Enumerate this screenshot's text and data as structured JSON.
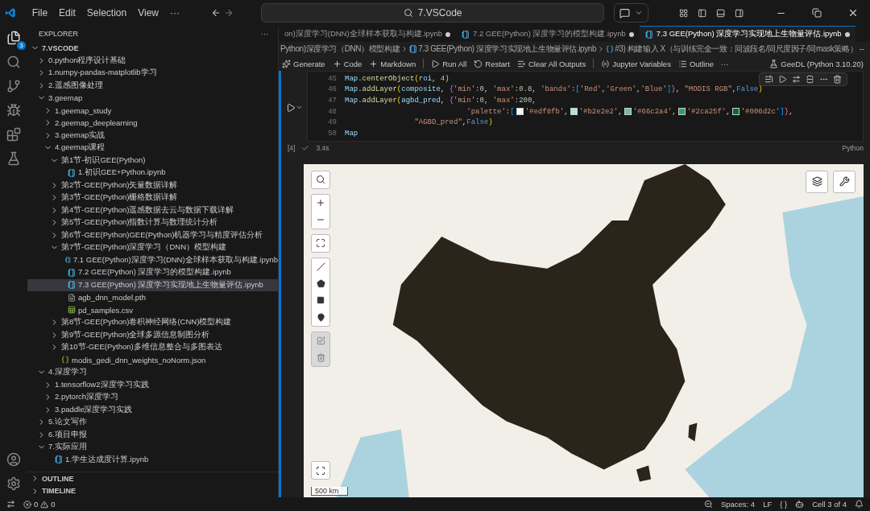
{
  "title_bar": {
    "menus": [
      "File",
      "Edit",
      "Selection",
      "View"
    ],
    "more": "···",
    "search": "7.VSCode"
  },
  "activity_bar": {
    "explorer_badge": "3"
  },
  "sidebar": {
    "title": "EXPLORER",
    "more": "···",
    "root": "7.VSCODE",
    "root_expanded": true,
    "items": [
      {
        "label": "0.python程序设计基础",
        "kind": "folder",
        "expanded": false,
        "selected": false
      },
      {
        "label": "1.numpy-pandas-matplotlib学习",
        "kind": "folder",
        "expanded": false,
        "selected": false
      },
      {
        "label": "2.遥感图像处理",
        "kind": "folder",
        "expanded": false,
        "selected": false
      },
      {
        "label": "3.geemap",
        "kind": "folder",
        "expanded": true,
        "selected": false,
        "children": [
          {
            "label": "1.geemap_study",
            "kind": "folder",
            "expanded": false,
            "selected": false
          },
          {
            "label": "2.geemap_deeplearning",
            "kind": "folder",
            "expanded": false,
            "selected": false
          },
          {
            "label": "3.geemap实战",
            "kind": "folder",
            "expanded": false,
            "selected": false
          },
          {
            "label": "4.geemap课程",
            "kind": "folder",
            "expanded": true,
            "selected": false,
            "children": [
              {
                "label": "第1节-初识GEE(Python)",
                "kind": "folder",
                "expanded": true,
                "selected": false,
                "children": [
                  {
                    "label": "1.初识GEE+Python.ipynb",
                    "kind": "notebook",
                    "selected": false
                  }
                ]
              },
              {
                "label": "第2节-GEE(Python)矢量数据详解",
                "kind": "folder",
                "expanded": false,
                "selected": false
              },
              {
                "label": "第3节-GEE(Python)栅格数据详解",
                "kind": "folder",
                "expanded": false,
                "selected": false
              },
              {
                "label": "第4节-GEE(Python)遥感数据去云与数据下载详解",
                "kind": "folder",
                "expanded": false,
                "selected": false
              },
              {
                "label": "第5节-GEE(Python)指数计算与数理统计分析",
                "kind": "folder",
                "expanded": false,
                "selected": false
              },
              {
                "label": "第6节-GEE(Python)GEE(Python)机器学习与精度评估分析",
                "kind": "folder",
                "expanded": false,
                "selected": false
              },
              {
                "label": "第7节-GEE(Python)深度学习（DNN）模型构建",
                "kind": "folder",
                "expanded": true,
                "selected": false,
                "children": [
                  {
                    "label": "7.1 GEE(Python)深度学习(DNN)全球样本获取与构建.ipynb",
                    "kind": "notebook",
                    "selected": false
                  },
                  {
                    "label": "7.2 GEE(Python) 深度学习的模型构建.ipynb",
                    "kind": "notebook",
                    "selected": false
                  },
                  {
                    "label": "7.3 GEE(Python) 深度学习实现地上生物量评估.ipynb",
                    "kind": "notebook",
                    "selected": true
                  },
                  {
                    "label": "agb_dnn_model.pth",
                    "kind": "file",
                    "selected": false
                  },
                  {
                    "label": "pd_samples.csv",
                    "kind": "csv",
                    "selected": false
                  }
                ]
              },
              {
                "label": "第8节-GEE(Python)卷积神经网络(CNN)模型构建",
                "kind": "folder",
                "expanded": false,
                "selected": false
              },
              {
                "label": "第9节-GEE(Python)全球多源信息制图分析",
                "kind": "folder",
                "expanded": false,
                "selected": false
              },
              {
                "label": "第10节-GEE(Python)多维信息整合与多图表达",
                "kind": "folder",
                "expanded": false,
                "selected": false
              },
              {
                "label": "modis_gedi_dnn_weights_noNorm.json",
                "kind": "json",
                "selected": false
              }
            ]
          }
        ]
      },
      {
        "label": "4.深度学习",
        "kind": "folder",
        "expanded": true,
        "selected": false,
        "children": [
          {
            "label": "1.tensorflow2深度学习实践",
            "kind": "folder",
            "expanded": false,
            "selected": false
          },
          {
            "label": "2.pytorch深度学习",
            "kind": "folder",
            "expanded": false,
            "selected": false
          },
          {
            "label": "3.paddle深度学习实践",
            "kind": "folder",
            "expanded": false,
            "selected": false
          }
        ]
      },
      {
        "label": "5.论文写作",
        "kind": "folder",
        "expanded": false,
        "selected": false
      },
      {
        "label": "6.项目申报",
        "kind": "folder",
        "expanded": false,
        "selected": false
      },
      {
        "label": "7.实际应用",
        "kind": "folder",
        "expanded": true,
        "selected": false,
        "children": [
          {
            "label": "1.学生达成度计算.ipynb",
            "kind": "notebook",
            "selected": false
          }
        ]
      }
    ],
    "sections": [
      {
        "label": "OUTLINE",
        "expanded": false
      },
      {
        "label": "TIMELINE",
        "expanded": false
      }
    ]
  },
  "tabs": [
    {
      "label": "on)深度学习(DNN)全球样本获取与构建.ipynb",
      "selected": false,
      "dirty": true
    },
    {
      "label": "7.2 GEE(Python) 深度学习的模型构建.ipynb",
      "selected": false,
      "dirty": true
    },
    {
      "label": "7.3 GEE(Python) 深度学习实现地上生物量评估.ipynb",
      "selected": true,
      "dirty": true
    }
  ],
  "breadcrumb": [
    "Python)深度学习（DNN）模型构建",
    "7.3 GEE(Python) 深度学习实现地上生物量评估.ipynb",
    "#3) 构建输入 X（与训练完全一致：同波段名/同尺度因子/同mask策略） --"
  ],
  "toolbar": [
    {
      "label": "Generate",
      "kind": "sparkle"
    },
    {
      "label": "Code",
      "kind": "plus"
    },
    {
      "label": "Markdown",
      "kind": "plus"
    },
    {
      "label": "Run All",
      "kind": "run"
    },
    {
      "label": "Restart",
      "kind": "restart"
    },
    {
      "label": "Clear All Outputs",
      "kind": "clear"
    },
    {
      "label": "Jupyter Variables",
      "kind": "variables"
    },
    {
      "label": "Outline",
      "kind": "list"
    }
  ],
  "toolbar_more": "···",
  "kernel": "GeeDL (Python 3.10.20)",
  "cell": {
    "selected": true,
    "lines": [
      {
        "no": "45",
        "segs": [
          {
            "kind": "v",
            "t": "Map"
          },
          {
            "kind": "p",
            "t": "."
          },
          {
            "kind": "f",
            "t": "centerObject"
          },
          {
            "kind": "b1",
            "t": "("
          },
          {
            "kind": "v",
            "t": "roi"
          },
          {
            "kind": "p",
            "t": ", "
          },
          {
            "kind": "n",
            "t": "4"
          },
          {
            "kind": "b1",
            "t": ")"
          }
        ]
      },
      {
        "no": "46",
        "segs": [
          {
            "kind": "v",
            "t": "Map"
          },
          {
            "kind": "p",
            "t": "."
          },
          {
            "kind": "f",
            "t": "addLayer"
          },
          {
            "kind": "b1",
            "t": "("
          },
          {
            "kind": "v",
            "t": "composite"
          },
          {
            "kind": "p",
            "t": ", "
          },
          {
            "kind": "b2",
            "t": "{"
          },
          {
            "kind": "s",
            "t": "'min'"
          },
          {
            "kind": "p",
            "t": ":"
          },
          {
            "kind": "n",
            "t": "0"
          },
          {
            "kind": "p",
            "t": ", "
          },
          {
            "kind": "s",
            "t": "'max'"
          },
          {
            "kind": "p",
            "t": ":"
          },
          {
            "kind": "n",
            "t": "0.8"
          },
          {
            "kind": "p",
            "t": ", "
          },
          {
            "kind": "s",
            "t": "'bands'"
          },
          {
            "kind": "p",
            "t": ":"
          },
          {
            "kind": "b3",
            "t": "["
          },
          {
            "kind": "s",
            "t": "'Red'"
          },
          {
            "kind": "p",
            "t": ","
          },
          {
            "kind": "s",
            "t": "'Green'"
          },
          {
            "kind": "p",
            "t": ","
          },
          {
            "kind": "s",
            "t": "'Blue'"
          },
          {
            "kind": "b3",
            "t": "]"
          },
          {
            "kind": "b2",
            "t": "}"
          },
          {
            "kind": "p",
            "t": ", "
          },
          {
            "kind": "s",
            "t": "\"MODIS RGB\""
          },
          {
            "kind": "p",
            "t": ","
          },
          {
            "kind": "k",
            "t": "False"
          },
          {
            "kind": "b1",
            "t": ")"
          }
        ]
      },
      {
        "no": "47",
        "segs": [
          {
            "kind": "v",
            "t": "Map"
          },
          {
            "kind": "p",
            "t": "."
          },
          {
            "kind": "f",
            "t": "addLayer"
          },
          {
            "kind": "b1",
            "t": "("
          },
          {
            "kind": "v",
            "t": "agbd_pred"
          },
          {
            "kind": "p",
            "t": ", "
          },
          {
            "kind": "b2",
            "t": "{"
          },
          {
            "kind": "s",
            "t": "'min'"
          },
          {
            "kind": "p",
            "t": ":"
          },
          {
            "kind": "n",
            "t": "0"
          },
          {
            "kind": "p",
            "t": ", "
          },
          {
            "kind": "s",
            "t": "'max'"
          },
          {
            "kind": "p",
            "t": ":"
          },
          {
            "kind": "n",
            "t": "200"
          },
          {
            "kind": "p",
            "t": ","
          }
        ]
      },
      {
        "no": "48",
        "segs": [
          {
            "kind": "s",
            "t": "                            'palette'"
          },
          {
            "kind": "p",
            "t": ":"
          },
          {
            "kind": "b3",
            "t": "["
          },
          {
            "kind": "sw",
            "color": "#edf8fb"
          },
          {
            "kind": "s",
            "t": "'#edf8fb'"
          },
          {
            "kind": "p",
            "t": ","
          },
          {
            "kind": "sw",
            "color": "#b2e2e2"
          },
          {
            "kind": "s",
            "t": "'#b2e2e2'"
          },
          {
            "kind": "p",
            "t": ","
          },
          {
            "kind": "sw",
            "color": "#66c2a4"
          },
          {
            "kind": "s",
            "t": "'#66c2a4'"
          },
          {
            "kind": "p",
            "t": ","
          },
          {
            "kind": "sw",
            "color": "#2ca25f"
          },
          {
            "kind": "s",
            "t": "'#2ca25f'"
          },
          {
            "kind": "p",
            "t": ","
          },
          {
            "kind": "sw",
            "color": "#006d2c"
          },
          {
            "kind": "s",
            "t": "'#006d2c'"
          },
          {
            "kind": "b3",
            "t": "]"
          },
          {
            "kind": "b2",
            "t": "}"
          },
          {
            "kind": "p",
            "t": ","
          }
        ]
      },
      {
        "no": "49",
        "segs": [
          {
            "kind": "s",
            "t": "                \"AGBD_pred\""
          },
          {
            "kind": "p",
            "t": ","
          },
          {
            "kind": "k",
            "t": "False"
          },
          {
            "kind": "b1",
            "t": ")"
          }
        ]
      },
      {
        "no": "50",
        "segs": [
          {
            "kind": "v",
            "t": "Map"
          }
        ]
      }
    ],
    "exec_count": "[4]",
    "duration": "3.4s",
    "language": "Python"
  },
  "map": {
    "scale": "500 km"
  },
  "status_bar": {
    "errors": "0",
    "warnings": "0",
    "spaces": "Spaces: 4",
    "eol": "LF",
    "braces": "{ }",
    "cell": "Cell 3 of 4"
  }
}
